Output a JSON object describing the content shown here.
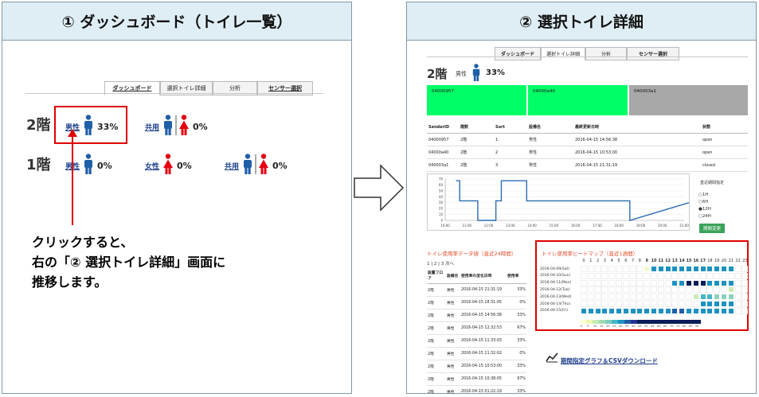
{
  "left_panel": {
    "title": "① ダッシュボード（トイレ一覧）",
    "tabs": [
      "ダッシュボード",
      "選択トイレ詳細",
      "分析",
      "センサー選択"
    ],
    "floors": [
      {
        "label": "2階",
        "rooms": [
          {
            "name": "男性",
            "percent": "33%",
            "type": "male"
          },
          {
            "name": "共用",
            "percent": "0%",
            "type": "shared"
          }
        ]
      },
      {
        "label": "1階",
        "rooms": [
          {
            "name": "男性",
            "percent": "0%",
            "type": "male"
          },
          {
            "name": "女性",
            "percent": "0%",
            "type": "female"
          },
          {
            "name": "共用",
            "percent": "0%",
            "type": "shared"
          }
        ]
      }
    ],
    "caption_lines": [
      "クリックすると、",
      "右の「② 選択トイレ詳細」画面に",
      "推移します。"
    ]
  },
  "right_panel": {
    "title": "② 選択トイレ詳細",
    "tabs": [
      "ダッシュボード",
      "選択トイレ詳細",
      "分析",
      "センサー選択"
    ],
    "floor": "2階",
    "gender": "男性",
    "percent": "33%",
    "sensor_blocks": [
      {
        "id": "04000957",
        "color": "#00ff66"
      },
      {
        "id": "04000a40",
        "color": "#00ff66"
      },
      {
        "id": "040003a1",
        "color": "#a8a8a8"
      }
    ],
    "sensor_table": {
      "headers": [
        "SenderID",
        "階数",
        "Sort",
        "設備名",
        "最終更新日時",
        "状態"
      ],
      "rows": [
        [
          "04000957",
          "2階",
          "1",
          "男性",
          "2016-04-15 14:56:38",
          "open"
        ],
        [
          "04000a40",
          "2階",
          "2",
          "男性",
          "2016-04-15 10:53:00",
          "open"
        ],
        [
          "040003a1",
          "2階",
          "3",
          "男性",
          "2016-04-15 21:31:19",
          "closed"
        ]
      ]
    },
    "period": {
      "title": "直近期間指定",
      "options": [
        "1H",
        "6H",
        "12H",
        "24H"
      ],
      "selected": "12H",
      "button": "期間変更"
    },
    "history": {
      "title": "トイレ使用率データ値（直近24時間）",
      "pager": "1 | 2 | 3 次へ",
      "headers": [
        "設置フロア",
        "設備名",
        "使用率の変化日時",
        "使用率"
      ],
      "rows": [
        [
          "2階",
          "男性",
          "2016-04-15 21:31:19",
          "33%"
        ],
        [
          "2階",
          "男性",
          "2016-04-15 18:31:05",
          "0%"
        ],
        [
          "2階",
          "男性",
          "2016-04-15 14:56:38",
          "33%"
        ],
        [
          "2階",
          "男性",
          "2016-04-15 12:32:53",
          "67%"
        ],
        [
          "2階",
          "男性",
          "2016-04-15 11:33:03",
          "33%"
        ],
        [
          "2階",
          "男性",
          "2016-04-15 11:32:02",
          "0%"
        ],
        [
          "2階",
          "男性",
          "2016-04-15 10:53:00",
          "33%"
        ],
        [
          "2階",
          "男性",
          "2016-04-15 10:38:05",
          "67%"
        ],
        [
          "2階",
          "男性",
          "2016-04-15 01:22:19",
          "33%"
        ],
        [
          "2階",
          "男性",
          "2016-04-14 23:37:26",
          "0%"
        ]
      ]
    },
    "heatmap": {
      "title": "トイレ使用率ヒートマップ（直近1週間）",
      "hours": [
        "0",
        "1",
        "2",
        "3",
        "4",
        "5",
        "6",
        "7",
        "8",
        "9",
        "10",
        "11",
        "12",
        "13",
        "14",
        "15",
        "16",
        "17",
        "18",
        "19",
        "20",
        "21",
        "22",
        "23"
      ],
      "bold_hours": [
        "9",
        "10",
        "11",
        "12",
        "13",
        "14",
        "15",
        "16",
        "17"
      ],
      "days": [
        "2016-04-09(Sat)",
        "2016-04-10(Sun)",
        "2016-04-11(Mon)",
        "2016-04-12(Tue)",
        "2016-04-13(Wed)",
        "2016-04-14(Thu)",
        "2016-04-15(Fri)"
      ],
      "legend_labels": [
        "0",
        "5",
        "10",
        "15",
        "20",
        "25",
        "30",
        "35",
        "40",
        "45",
        "50",
        "55",
        "60",
        "65",
        "70",
        "75",
        "80",
        "85",
        "90"
      ]
    },
    "csv_link": "期間指定グラフ＆CSVダウンロード"
  },
  "chart_data": {
    "type": "line",
    "title": "",
    "xlabel": "",
    "ylabel": "",
    "ylim": [
      0,
      70
    ],
    "y_ticks": [
      0,
      10,
      20,
      30,
      40,
      50,
      60,
      70
    ],
    "x_ticks": [
      "10:00",
      "11:00",
      "12:00",
      "13:00",
      "14:00",
      "15:00",
      "16:00",
      "17:00",
      "18:00",
      "19:00",
      "20:00",
      "21:00"
    ],
    "series": [
      {
        "x": [
          "10:30",
          "10:40",
          "10:40",
          "11:30",
          "11:30",
          "12:20",
          "12:20",
          "12:35",
          "12:35",
          "13:45",
          "13:45",
          "14:55",
          "14:55",
          "18:30",
          "18:30",
          "21:30"
        ],
        "y": [
          67,
          67,
          33,
          33,
          0,
          0,
          33,
          33,
          67,
          67,
          33,
          33,
          33,
          33,
          0,
          33
        ]
      }
    ]
  },
  "colors": {
    "male": "#1f5fa8",
    "female": "#e60012",
    "highlight": "#e00000",
    "header_bg": "#dfeef4",
    "line": "#2a6db0"
  }
}
